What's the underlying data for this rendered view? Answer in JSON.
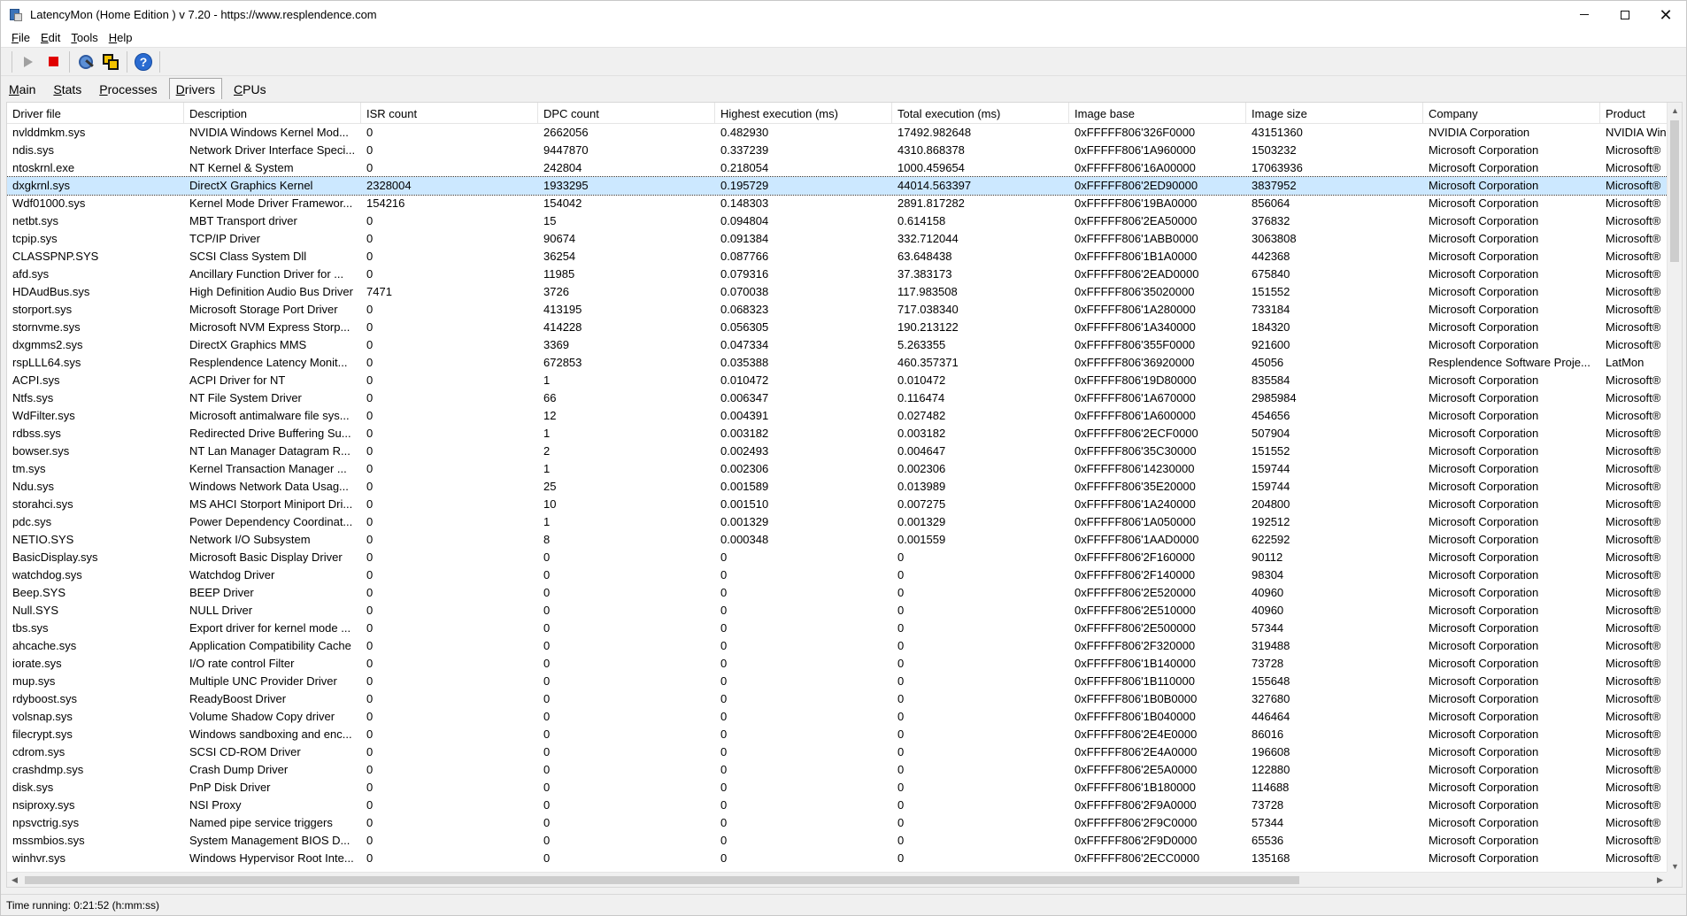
{
  "window": {
    "title": "LatencyMon  (Home Edition )  v 7.20 - https://www.resplendence.com"
  },
  "menu": {
    "items": [
      {
        "label": "File",
        "key": "F",
        "rest": "ile"
      },
      {
        "label": "Edit",
        "key": "E",
        "rest": "dit"
      },
      {
        "label": "Tools",
        "key": "T",
        "rest": "ools"
      },
      {
        "label": "Help",
        "key": "H",
        "rest": "elp"
      }
    ]
  },
  "toolbar": {
    "icons": [
      "play-icon",
      "stop-icon",
      "tool-icon",
      "windows-icon",
      "help-icon"
    ]
  },
  "tabs": [
    {
      "label": "Main",
      "key": "M",
      "rest": "ain"
    },
    {
      "label": "Stats",
      "key": "S",
      "rest": "tats"
    },
    {
      "label": "Processes",
      "key": "P",
      "rest": "rocesses"
    },
    {
      "label": "Drivers",
      "key": "D",
      "rest": "rivers",
      "active": true
    },
    {
      "label": "CPUs",
      "key": "C",
      "rest": "PUs"
    }
  ],
  "table": {
    "columns": [
      "Driver file",
      "Description",
      "ISR count",
      "DPC count",
      "Highest execution (ms)",
      "Total execution (ms)",
      "Image base",
      "Image size",
      "Company",
      "Product"
    ],
    "selected_index": 3,
    "rows": [
      [
        "nvlddmkm.sys",
        "NVIDIA Windows Kernel Mod...",
        "0",
        "2662056",
        "0.482930",
        "17492.982648",
        "0xFFFFF806'326F0000",
        "43151360",
        "NVIDIA Corporation",
        "NVIDIA Win"
      ],
      [
        "ndis.sys",
        "Network Driver Interface Speci...",
        "0",
        "9447870",
        "0.337239",
        "4310.868378",
        "0xFFFFF806'1A960000",
        "1503232",
        "Microsoft Corporation",
        "Microsoft®"
      ],
      [
        "ntoskrnl.exe",
        "NT Kernel & System",
        "0",
        "242804",
        "0.218054",
        "1000.459654",
        "0xFFFFF806'16A00000",
        "17063936",
        "Microsoft Corporation",
        "Microsoft®"
      ],
      [
        "dxgkrnl.sys",
        "DirectX Graphics Kernel",
        "2328004",
        "1933295",
        "0.195729",
        "44014.563397",
        "0xFFFFF806'2ED90000",
        "3837952",
        "Microsoft Corporation",
        "Microsoft®"
      ],
      [
        "Wdf01000.sys",
        "Kernel Mode Driver Framewor...",
        "154216",
        "154042",
        "0.148303",
        "2891.817282",
        "0xFFFFF806'19BA0000",
        "856064",
        "Microsoft Corporation",
        "Microsoft®"
      ],
      [
        "netbt.sys",
        "MBT Transport driver",
        "0",
        "15",
        "0.094804",
        "0.614158",
        "0xFFFFF806'2EA50000",
        "376832",
        "Microsoft Corporation",
        "Microsoft®"
      ],
      [
        "tcpip.sys",
        "TCP/IP Driver",
        "0",
        "90674",
        "0.091384",
        "332.712044",
        "0xFFFFF806'1ABB0000",
        "3063808",
        "Microsoft Corporation",
        "Microsoft®"
      ],
      [
        "CLASSPNP.SYS",
        "SCSI Class System Dll",
        "0",
        "36254",
        "0.087766",
        "63.648438",
        "0xFFFFF806'1B1A0000",
        "442368",
        "Microsoft Corporation",
        "Microsoft®"
      ],
      [
        "afd.sys",
        "Ancillary Function Driver for ...",
        "0",
        "11985",
        "0.079316",
        "37.383173",
        "0xFFFFF806'2EAD0000",
        "675840",
        "Microsoft Corporation",
        "Microsoft®"
      ],
      [
        "HDAudBus.sys",
        "High Definition Audio Bus Driver",
        "7471",
        "3726",
        "0.070038",
        "117.983508",
        "0xFFFFF806'35020000",
        "151552",
        "Microsoft Corporation",
        "Microsoft®"
      ],
      [
        "storport.sys",
        "Microsoft Storage Port Driver",
        "0",
        "413195",
        "0.068323",
        "717.038340",
        "0xFFFFF806'1A280000",
        "733184",
        "Microsoft Corporation",
        "Microsoft®"
      ],
      [
        "stornvme.sys",
        "Microsoft NVM Express Storp...",
        "0",
        "414228",
        "0.056305",
        "190.213122",
        "0xFFFFF806'1A340000",
        "184320",
        "Microsoft Corporation",
        "Microsoft®"
      ],
      [
        "dxgmms2.sys",
        "DirectX Graphics MMS",
        "0",
        "3369",
        "0.047334",
        "5.263355",
        "0xFFFFF806'355F0000",
        "921600",
        "Microsoft Corporation",
        "Microsoft®"
      ],
      [
        "rspLLL64.sys",
        "Resplendence Latency Monit...",
        "0",
        "672853",
        "0.035388",
        "460.357371",
        "0xFFFFF806'36920000",
        "45056",
        "Resplendence Software Proje...",
        "LatMon"
      ],
      [
        "ACPI.sys",
        "ACPI Driver for NT",
        "0",
        "1",
        "0.010472",
        "0.010472",
        "0xFFFFF806'19D80000",
        "835584",
        "Microsoft Corporation",
        "Microsoft®"
      ],
      [
        "Ntfs.sys",
        "NT File System Driver",
        "0",
        "66",
        "0.006347",
        "0.116474",
        "0xFFFFF806'1A670000",
        "2985984",
        "Microsoft Corporation",
        "Microsoft®"
      ],
      [
        "WdFilter.sys",
        "Microsoft antimalware file sys...",
        "0",
        "12",
        "0.004391",
        "0.027482",
        "0xFFFFF806'1A600000",
        "454656",
        "Microsoft Corporation",
        "Microsoft®"
      ],
      [
        "rdbss.sys",
        "Redirected Drive Buffering Su...",
        "0",
        "1",
        "0.003182",
        "0.003182",
        "0xFFFFF806'2ECF0000",
        "507904",
        "Microsoft Corporation",
        "Microsoft®"
      ],
      [
        "bowser.sys",
        "NT Lan Manager Datagram R...",
        "0",
        "2",
        "0.002493",
        "0.004647",
        "0xFFFFF806'35C30000",
        "151552",
        "Microsoft Corporation",
        "Microsoft®"
      ],
      [
        "tm.sys",
        "Kernel Transaction Manager ...",
        "0",
        "1",
        "0.002306",
        "0.002306",
        "0xFFFFF806'14230000",
        "159744",
        "Microsoft Corporation",
        "Microsoft®"
      ],
      [
        "Ndu.sys",
        "Windows Network Data Usag...",
        "0",
        "25",
        "0.001589",
        "0.013989",
        "0xFFFFF806'35E20000",
        "159744",
        "Microsoft Corporation",
        "Microsoft®"
      ],
      [
        "storahci.sys",
        "MS AHCI Storport Miniport Dri...",
        "0",
        "10",
        "0.001510",
        "0.007275",
        "0xFFFFF806'1A240000",
        "204800",
        "Microsoft Corporation",
        "Microsoft®"
      ],
      [
        "pdc.sys",
        "Power Dependency Coordinat...",
        "0",
        "1",
        "0.001329",
        "0.001329",
        "0xFFFFF806'1A050000",
        "192512",
        "Microsoft Corporation",
        "Microsoft®"
      ],
      [
        "NETIO.SYS",
        "Network I/O Subsystem",
        "0",
        "8",
        "0.000348",
        "0.001559",
        "0xFFFFF806'1AAD0000",
        "622592",
        "Microsoft Corporation",
        "Microsoft®"
      ],
      [
        "BasicDisplay.sys",
        "Microsoft Basic Display Driver",
        "0",
        "0",
        "0",
        "0",
        "0xFFFFF806'2F160000",
        "90112",
        "Microsoft Corporation",
        "Microsoft®"
      ],
      [
        "watchdog.sys",
        "Watchdog Driver",
        "0",
        "0",
        "0",
        "0",
        "0xFFFFF806'2F140000",
        "98304",
        "Microsoft Corporation",
        "Microsoft®"
      ],
      [
        "Beep.SYS",
        "BEEP Driver",
        "0",
        "0",
        "0",
        "0",
        "0xFFFFF806'2E520000",
        "40960",
        "Microsoft Corporation",
        "Microsoft®"
      ],
      [
        "Null.SYS",
        "NULL Driver",
        "0",
        "0",
        "0",
        "0",
        "0xFFFFF806'2E510000",
        "40960",
        "Microsoft Corporation",
        "Microsoft®"
      ],
      [
        "tbs.sys",
        "Export driver for kernel mode ...",
        "0",
        "0",
        "0",
        "0",
        "0xFFFFF806'2E500000",
        "57344",
        "Microsoft Corporation",
        "Microsoft®"
      ],
      [
        "ahcache.sys",
        "Application Compatibility Cache",
        "0",
        "0",
        "0",
        "0",
        "0xFFFFF806'2F320000",
        "319488",
        "Microsoft Corporation",
        "Microsoft®"
      ],
      [
        "iorate.sys",
        "I/O rate control Filter",
        "0",
        "0",
        "0",
        "0",
        "0xFFFFF806'1B140000",
        "73728",
        "Microsoft Corporation",
        "Microsoft®"
      ],
      [
        "mup.sys",
        "Multiple UNC Provider Driver",
        "0",
        "0",
        "0",
        "0",
        "0xFFFFF806'1B110000",
        "155648",
        "Microsoft Corporation",
        "Microsoft®"
      ],
      [
        "rdyboost.sys",
        "ReadyBoost Driver",
        "0",
        "0",
        "0",
        "0",
        "0xFFFFF806'1B0B0000",
        "327680",
        "Microsoft Corporation",
        "Microsoft®"
      ],
      [
        "volsnap.sys",
        "Volume Shadow Copy driver",
        "0",
        "0",
        "0",
        "0",
        "0xFFFFF806'1B040000",
        "446464",
        "Microsoft Corporation",
        "Microsoft®"
      ],
      [
        "filecrypt.sys",
        "Windows sandboxing and enc...",
        "0",
        "0",
        "0",
        "0",
        "0xFFFFF806'2E4E0000",
        "86016",
        "Microsoft Corporation",
        "Microsoft®"
      ],
      [
        "cdrom.sys",
        "SCSI CD-ROM Driver",
        "0",
        "0",
        "0",
        "0",
        "0xFFFFF806'2E4A0000",
        "196608",
        "Microsoft Corporation",
        "Microsoft®"
      ],
      [
        "crashdmp.sys",
        "Crash Dump Driver",
        "0",
        "0",
        "0",
        "0",
        "0xFFFFF806'2E5A0000",
        "122880",
        "Microsoft Corporation",
        "Microsoft®"
      ],
      [
        "disk.sys",
        "PnP Disk Driver",
        "0",
        "0",
        "0",
        "0",
        "0xFFFFF806'1B180000",
        "114688",
        "Microsoft Corporation",
        "Microsoft®"
      ],
      [
        "nsiproxy.sys",
        "NSI Proxy",
        "0",
        "0",
        "0",
        "0",
        "0xFFFFF806'2F9A0000",
        "73728",
        "Microsoft Corporation",
        "Microsoft®"
      ],
      [
        "npsvctrig.sys",
        "Named pipe service triggers",
        "0",
        "0",
        "0",
        "0",
        "0xFFFFF806'2F9C0000",
        "57344",
        "Microsoft Corporation",
        "Microsoft®"
      ],
      [
        "mssmbios.sys",
        "System Management BIOS D...",
        "0",
        "0",
        "0",
        "0",
        "0xFFFFF806'2F9D0000",
        "65536",
        "Microsoft Corporation",
        "Microsoft®"
      ],
      [
        "winhvr.sys",
        "Windows Hypervisor Root Inte...",
        "0",
        "0",
        "0",
        "0",
        "0xFFFFF806'2ECC0000",
        "135168",
        "Microsoft Corporation",
        "Microsoft®"
      ]
    ]
  },
  "status": {
    "time_running": "Time running: 0:21:52  (h:mm:ss)"
  }
}
